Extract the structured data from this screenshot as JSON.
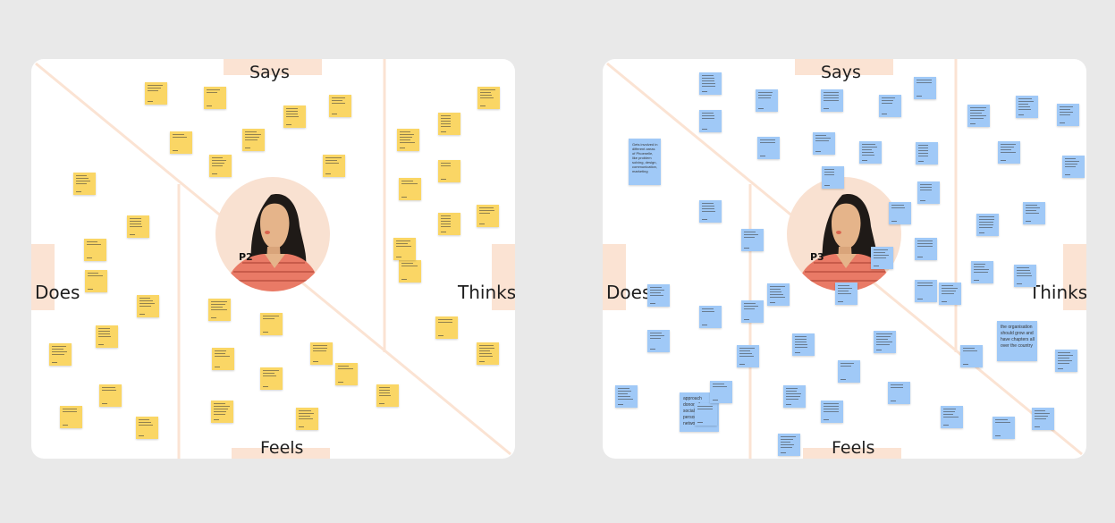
{
  "boards": [
    {
      "id": "board-p2",
      "persona_code": "P2",
      "labels": {
        "says": "Says",
        "thinks": "Thinks",
        "does": "Does",
        "feels": "Feels"
      },
      "note_color": "#fad665",
      "note_count": 38
    },
    {
      "id": "board-p3",
      "persona_code": "P3",
      "labels": {
        "says": "Says",
        "thinks": "Thinks",
        "does": "Does",
        "feels": "Feels"
      },
      "note_color": "#a0c9f7",
      "note_count": 50,
      "readable_notes": {
        "does_1": "approach donors through social media a personal network",
        "thinks_1": "the organisation should grow and have chapters all over the country",
        "does_2": "Gets involved in different areas of Phoenelle, like problem solving, design, communication, marketing"
      }
    }
  ],
  "colors": {
    "background": "#e9e9e9",
    "board": "#ffffff",
    "tab": "#fbe3d3",
    "divider": "#fbe3d3",
    "yellow_note": "#fad665",
    "blue_note": "#a0c9f7",
    "avatar_bg": "#f9e1d1",
    "shirt": "#e97a66",
    "skin": "#e5b48a",
    "hair": "#1f1a17"
  }
}
